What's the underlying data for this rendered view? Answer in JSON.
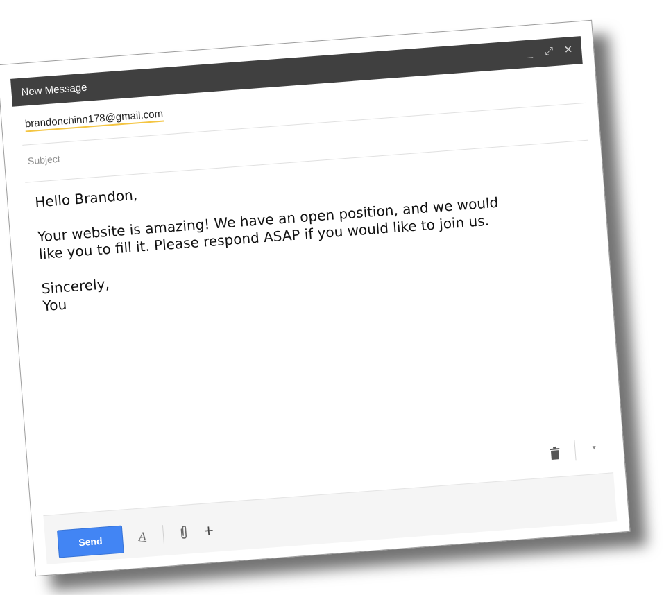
{
  "window": {
    "title": "New Message",
    "controls": {
      "minimize": "_",
      "expand": "⤢",
      "close": "✕"
    }
  },
  "to": {
    "recipient": "brandonchinn178@gmail.com"
  },
  "subject": {
    "value": "",
    "placeholder": "Subject"
  },
  "body": {
    "greeting": "Hello Brandon,",
    "paragraph_lines": [
      "Your website is amazing! We have an open position, and we would",
      "like you to fill it. Please respond ASAP if you would like to join us."
    ],
    "signoff": "Sincerely,",
    "signature": "You"
  },
  "toolbar": {
    "send_label": "Send",
    "format_icon": "A",
    "attach_icon": "paperclip-icon",
    "plus_label": "+",
    "trash_icon": "trash-icon",
    "more_icon": "▾"
  },
  "colors": {
    "titlebar": "#404040",
    "send_button": "#4285f4",
    "recipient_underline": "#f4c542"
  }
}
